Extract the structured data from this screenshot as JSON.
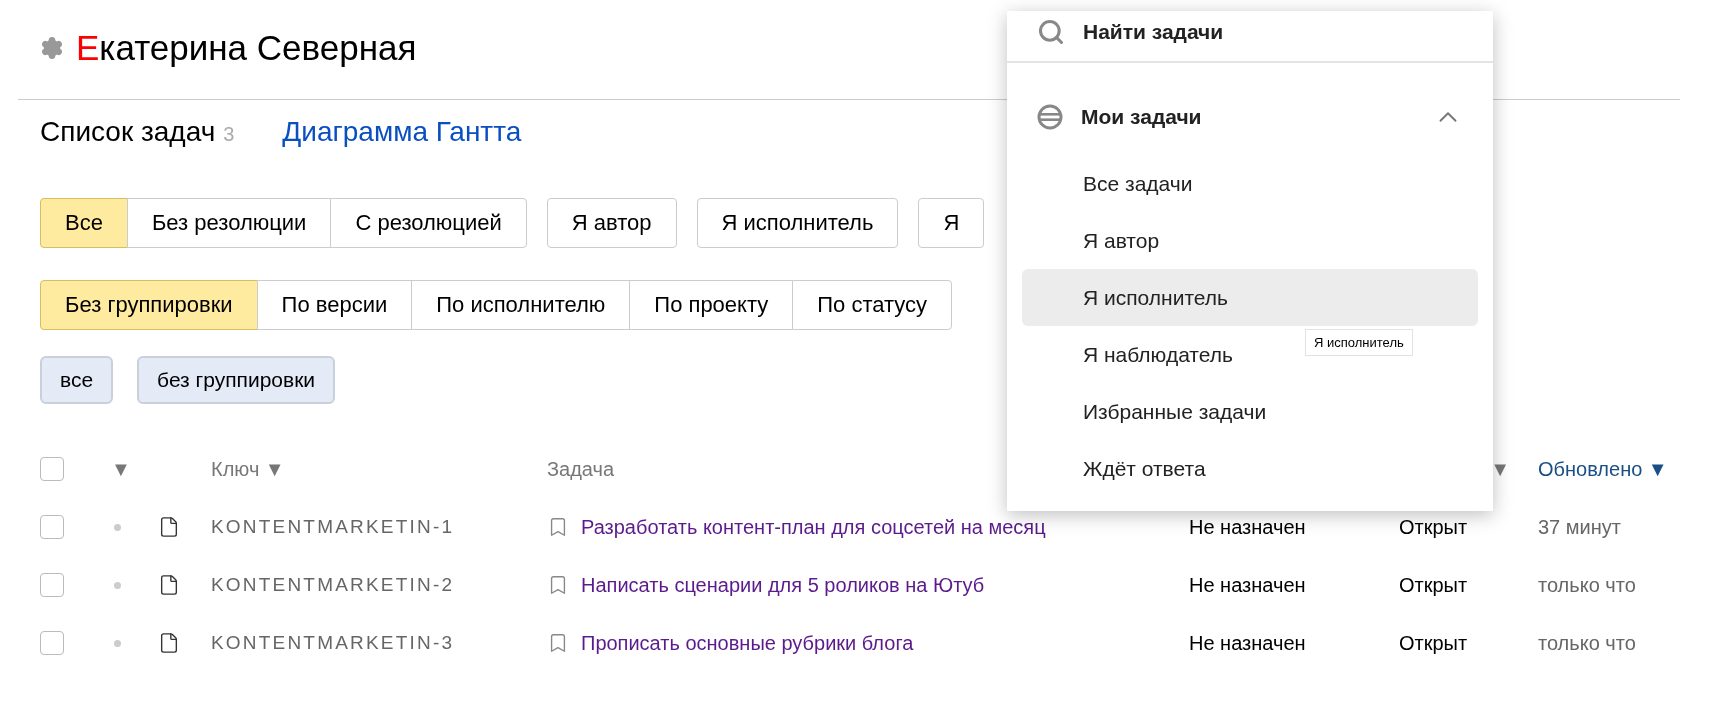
{
  "header": {
    "accent_letter": "Е",
    "title": "катерина Северная"
  },
  "tabs": [
    {
      "label": "Список задач",
      "count": "3",
      "selected": true
    },
    {
      "label": "Диаграмма Гантта",
      "selected": false
    }
  ],
  "filter_groups": [
    [
      {
        "label": "Все",
        "selected": true
      },
      {
        "label": "Без резолюции",
        "selected": false
      },
      {
        "label": "С резолюцией",
        "selected": false
      }
    ],
    [
      {
        "label": "Я автор",
        "selected": false
      }
    ],
    [
      {
        "label": "Я исполнитель",
        "selected": false
      }
    ],
    [
      {
        "label": "Я",
        "selected": false
      }
    ]
  ],
  "grouping": [
    {
      "label": "Без группировки",
      "selected": true
    },
    {
      "label": "По версии",
      "selected": false
    },
    {
      "label": "По исполнителю",
      "selected": false
    },
    {
      "label": "По проекту",
      "selected": false
    },
    {
      "label": "По статусу",
      "selected": false
    }
  ],
  "chips": [
    "все",
    "без группировки"
  ],
  "table": {
    "select_all_checked": false,
    "columns": [
      {
        "kind": "expand",
        "label": "▼",
        "selected": false
      },
      {
        "kind": "key",
        "label": "Ключ ▼",
        "selected": false
      },
      {
        "kind": "task",
        "label": "Задача",
        "selected": false
      },
      {
        "kind": "status",
        "label": "▼",
        "selected": false
      },
      {
        "kind": "updated",
        "label": "Обновлено ▼",
        "selected": true
      }
    ],
    "rows": [
      {
        "checked": false,
        "key": "KONTENTMARKETIN-1",
        "task": "Разработать контент-план для соцсетей на месяц",
        "assignee": "Не назначен",
        "status": "Открыт",
        "updated": "37 минут"
      },
      {
        "checked": false,
        "key": "KONTENTMARKETIN-2",
        "task": "Написать сценарии для 5 роликов на Ютуб",
        "assignee": "Не назначен",
        "status": "Открыт",
        "updated": "только что"
      },
      {
        "checked": false,
        "key": "KONTENTMARKETIN-3",
        "task": "Прописать основные рубрики блога",
        "assignee": "Не назначен",
        "status": "Открыт",
        "updated": "только что"
      }
    ]
  },
  "dropdown": {
    "search_label": "Найти задачи",
    "section": {
      "title": "Мои задачи",
      "expanded": true
    },
    "items": [
      {
        "label": "Все задачи",
        "selected": false
      },
      {
        "label": "Я автор",
        "selected": false
      },
      {
        "label": "Я исполнитель",
        "selected": true
      },
      {
        "label": "Я наблюдатель",
        "selected": false
      },
      {
        "label": "Избранные задачи",
        "selected": false
      },
      {
        "label": "Ждёт ответа",
        "selected": false
      }
    ],
    "tooltip": "Я исполнитель"
  }
}
